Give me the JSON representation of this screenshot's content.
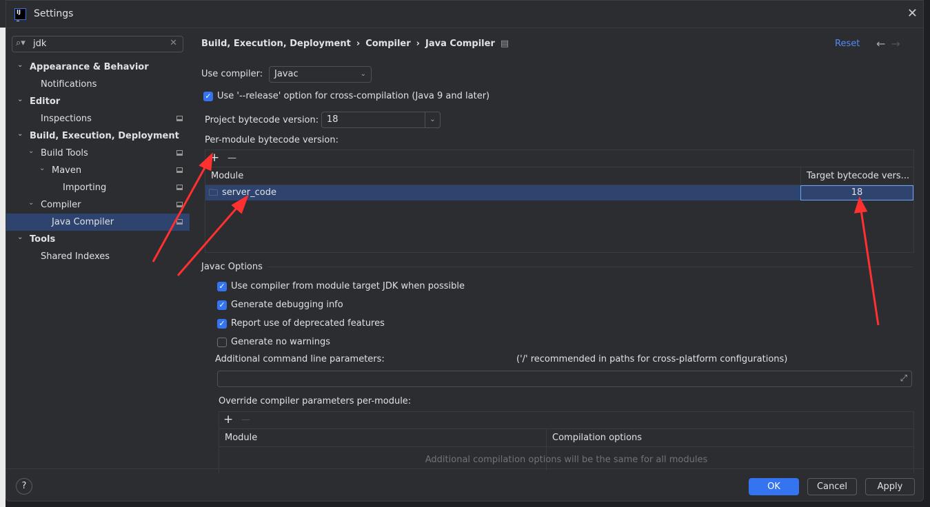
{
  "window": {
    "title": "Settings",
    "close": "✕",
    "logo": "IJ"
  },
  "search": {
    "value": "jdk",
    "icon": "search-icon",
    "clear": "✕"
  },
  "sidebar": {
    "items": [
      {
        "label": "Appearance & Behavior",
        "level": 0,
        "expanded": true,
        "bold": true
      },
      {
        "label": "Notifications",
        "level": 1
      },
      {
        "label": "Editor",
        "level": 0,
        "expanded": true,
        "bold": true
      },
      {
        "label": "Inspections",
        "level": 1,
        "mark": true
      },
      {
        "label": "Build, Execution, Deployment",
        "level": 0,
        "expanded": true,
        "bold": true
      },
      {
        "label": "Build Tools",
        "level": 1,
        "expanded": true,
        "mark": true
      },
      {
        "label": "Maven",
        "level": 2,
        "expanded": true,
        "mark": true
      },
      {
        "label": "Importing",
        "level": 3,
        "mark": true
      },
      {
        "label": "Compiler",
        "level": 1,
        "expanded": true,
        "mark": true
      },
      {
        "label": "Java Compiler",
        "level": 2,
        "selected": true,
        "mark": true
      },
      {
        "label": "Tools",
        "level": 0,
        "expanded": true,
        "bold": true
      },
      {
        "label": "Shared Indexes",
        "level": 1
      }
    ]
  },
  "breadcrumb": [
    "Build, Execution, Deployment",
    "›",
    "Compiler",
    "›",
    "Java Compiler"
  ],
  "header": {
    "reset": "Reset",
    "back": "←",
    "forward": "→"
  },
  "compiler": {
    "label": "Use compiler:",
    "value": "Javac"
  },
  "release_option": {
    "label": "Use '--release' option for cross-compilation (Java 9 and later)",
    "checked": true
  },
  "bytecode": {
    "label": "Project bytecode version:",
    "value": "18"
  },
  "per_module": {
    "label": "Per-module bytecode version:",
    "add": "+",
    "remove": "—",
    "columns": [
      "Module",
      "Target bytecode vers..."
    ],
    "rows": [
      {
        "module": "server_code",
        "target": "18"
      }
    ]
  },
  "javac": {
    "title": "Javac Options",
    "options": [
      {
        "label": "Use compiler from module target JDK when possible",
        "checked": true
      },
      {
        "label": "Generate debugging info",
        "checked": true
      },
      {
        "label": "Report use of deprecated features",
        "checked": true
      },
      {
        "label": "Generate no warnings",
        "checked": false
      }
    ],
    "cmd_label": "Additional command line parameters:",
    "cmd_hint": "('/' recommended in paths for cross-platform configurations)",
    "cmd_value": "",
    "override_label": "Override compiler parameters per-module:",
    "override_columns": [
      "Module",
      "Compilation options"
    ],
    "override_empty": "Additional compilation options will be the same for all modules"
  },
  "footer": {
    "help": "?",
    "ok": "OK",
    "cancel": "Cancel",
    "apply": "Apply"
  },
  "colors": {
    "accent": "#3574f0",
    "selection": "#2e436e",
    "annotation": "#ff3030"
  }
}
